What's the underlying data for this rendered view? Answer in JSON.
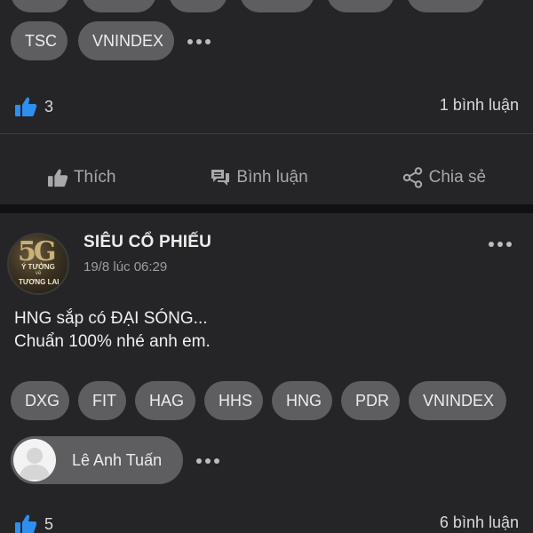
{
  "post1": {
    "stub_tag_count": 6,
    "tags": [
      "TSC",
      "VNINDEX"
    ],
    "likes": "3",
    "comments": "1 bình luận"
  },
  "actions": {
    "like": "Thích",
    "comment": "Bình luận",
    "share": "Chia sẻ"
  },
  "post2": {
    "author": "SIÊU CỔ PHIẾU",
    "timestamp": "19/8 lúc 06:29",
    "avatar_text": {
      "big": "5G",
      "line1": "Ý TƯỞNG",
      "line2": "về",
      "line3": "TƯƠNG LAI"
    },
    "text_line1": "HNG sắp có ĐẠI SÓNG...",
    "text_line2": "Chuẩn 100% nhé anh em.",
    "tags": [
      "DXG",
      "FIT",
      "HAG",
      "HHS",
      "HNG",
      "PDR",
      "VNINDEX"
    ],
    "tagged_user": "Lê Anh Tuấn",
    "likes": "5",
    "comments": "6 bình luận"
  },
  "colors": {
    "background": "#111113",
    "card": "#252527",
    "chip": "#5e5e61",
    "like_blue": "#2e8ff0",
    "muted_text": "#a8a8ab"
  },
  "icons": {
    "like": "thumbs-up-icon",
    "comment": "chat-bubble-icon",
    "share": "share-icon",
    "more": "more-dots-icon"
  }
}
